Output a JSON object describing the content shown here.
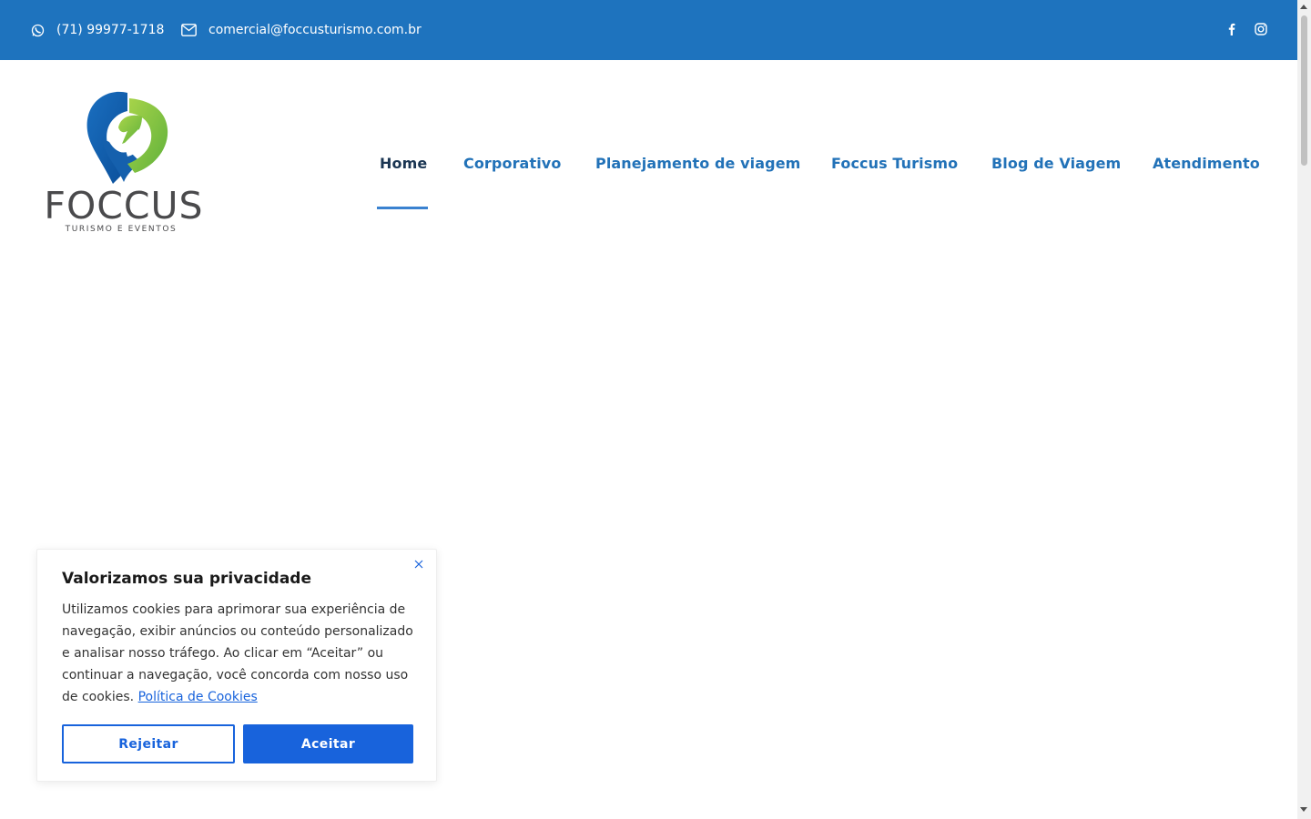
{
  "topbar": {
    "phone": "(71) 99977-1718",
    "email": "comercial@foccusturismo.com.br",
    "phone_icon": "whatsapp-icon",
    "email_icon": "envelope-icon",
    "social": [
      "facebook-icon",
      "instagram-icon"
    ],
    "background": "#1e73be"
  },
  "logo": {
    "name": "FOCCUS",
    "tagline": "TURISMO E EVENTOS"
  },
  "nav": {
    "items": [
      {
        "label": "Home",
        "active": true
      },
      {
        "label": "Corporativo"
      },
      {
        "label": "Planejamento de viagem"
      },
      {
        "label": "Foccus Turismo"
      },
      {
        "label": "Blog de Viagem"
      },
      {
        "label": "Atendimento"
      }
    ],
    "color": "#2272b8",
    "active_color": "#1a3552"
  },
  "cookie": {
    "title": "Valorizamos sua privacidade",
    "text": "Utilizamos cookies para aprimorar sua experiência de navegação, exibir anúncios ou conteúdo personalizado e analisar nosso tráfego. Ao clicar em “Aceitar” ou continuar a navegação, você concorda com nosso uso de cookies.",
    "link": "Política de Cookies",
    "reject": "Rejeitar",
    "accept": "Aceitar",
    "accent": "#1863dc"
  }
}
